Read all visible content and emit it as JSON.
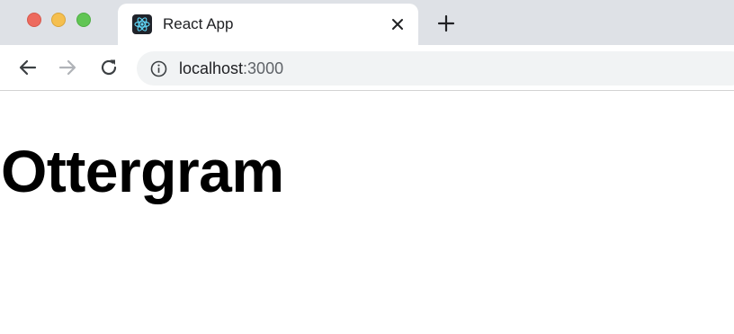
{
  "browser": {
    "tab": {
      "title": "React App",
      "favicon": "react-logo-icon"
    },
    "new_tab_icon": "plus-icon",
    "close_tab_icon": "close-icon",
    "nav": {
      "back_icon": "arrow-left-icon",
      "forward_icon": "arrow-right-icon",
      "reload_icon": "reload-icon"
    },
    "address": {
      "info_icon": "info-icon",
      "host": "localhost",
      "port": ":3000"
    },
    "colors": {
      "titlebar": "#dee1e6",
      "omnibox": "#f1f3f4",
      "traffic_red": "#ed6a5e",
      "traffic_yellow": "#f5bf4f",
      "traffic_green": "#61c554",
      "react_blue": "#61dafb"
    }
  },
  "page": {
    "heading": "Ottergram"
  }
}
